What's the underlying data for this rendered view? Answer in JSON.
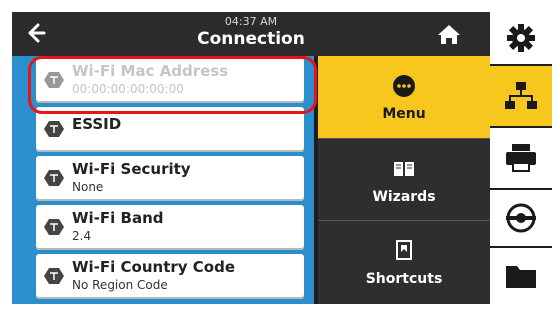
{
  "header": {
    "time": "04:37 AM",
    "title": "Connection"
  },
  "list": {
    "items": [
      {
        "label": "Wi-Fi Mac Address",
        "value": "00:00:00:00:00:00",
        "state": "disabled"
      },
      {
        "label": "ESSID",
        "value": ""
      },
      {
        "label": "Wi-Fi Security",
        "value": "None"
      },
      {
        "label": "Wi-Fi Band",
        "value": "2.4"
      },
      {
        "label": "Wi-Fi Country Code",
        "value": "No Region Code"
      }
    ]
  },
  "menu": {
    "menu_label": "Menu",
    "wizards_label": "Wizards",
    "shortcuts_label": "Shortcuts"
  },
  "colors": {
    "accent_yellow": "#f8c71d",
    "list_blue": "#2b8fce",
    "highlight_red": "#e8141a",
    "dark_bg": "#1d1d1d"
  },
  "icons": {
    "back": "arrow-left-icon",
    "home": "home-icon",
    "settings": "gear-icon",
    "network": "network-icon",
    "printer": "printer-icon",
    "media": "media-roll-icon",
    "folder": "folder-icon"
  }
}
